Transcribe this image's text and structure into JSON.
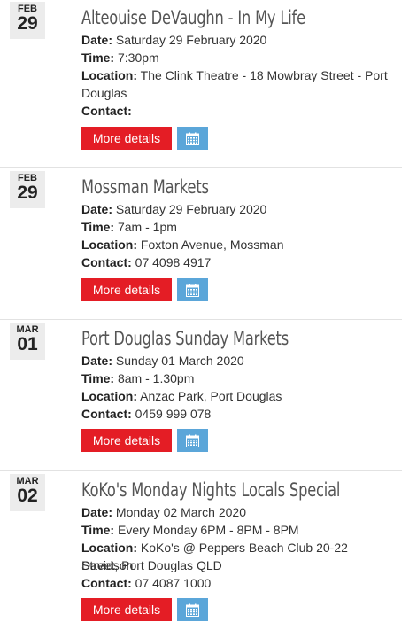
{
  "labels": {
    "date": "Date:",
    "time": "Time:",
    "location": "Location:",
    "contact": "Contact:",
    "more_details": "More details",
    "calendar_icon": "calendar-icon"
  },
  "events": [
    {
      "month": "FEB",
      "day": "29",
      "title": "Alteouise DeVaughn - In My Life",
      "date": "Saturday 29 February 2020",
      "time": "7:30pm",
      "location_line1": "The Clink Theatre - 18 Mowbray Street - Port",
      "location_line2": "Douglas",
      "contact": ""
    },
    {
      "month": "FEB",
      "day": "29",
      "title": "Mossman Markets",
      "date": "Saturday 29 February 2020",
      "time": "7am - 1pm",
      "location": "Foxton Avenue, Mossman",
      "contact": "07 4098 4917"
    },
    {
      "month": "MAR",
      "day": "01",
      "title": "Port Douglas Sunday Markets",
      "date": "Sunday 01 March 2020",
      "time": "8am - 1.30pm",
      "location": "Anzac Park, Port Douglas",
      "contact": "0459 999 078"
    },
    {
      "month": "MAR",
      "day": "02",
      "title": "KoKo's Monday Nights Locals Special",
      "date": "Monday 02 March 2020",
      "time": "Every Monday 6PM - 8PM - 8PM",
      "location_line1": "KoKo's @ Peppers Beach Club 20-22 Davidson",
      "location_line2": "Street, Port Douglas QLD",
      "contact": "07 4087 1000"
    }
  ],
  "colors": {
    "more_button": "#e41d25",
    "calendar_button": "#5ba6d9",
    "date_box": "#ececec"
  }
}
